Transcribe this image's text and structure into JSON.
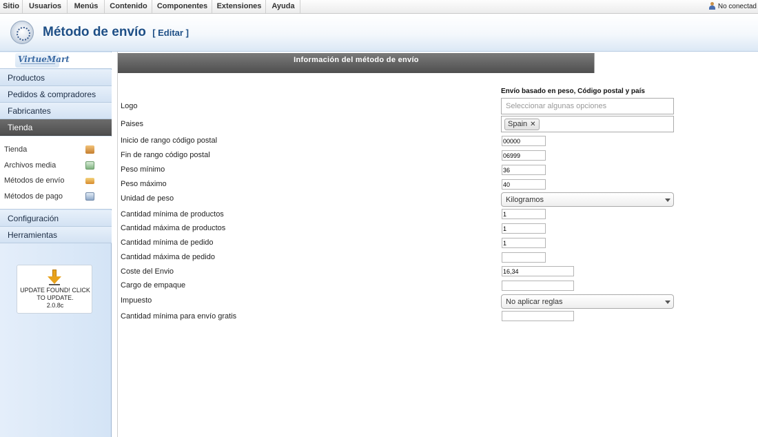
{
  "topmenu": {
    "items": [
      "Sitio",
      "Usuarios",
      "Menús",
      "Contenido",
      "Componentes",
      "Extensiones",
      "Ayuda"
    ],
    "status": "No conectad"
  },
  "header": {
    "title": "Método de envío",
    "edit_label": "[ Editar ]"
  },
  "sidebar": {
    "logo_text": "VirtueMart",
    "sections": [
      "Productos",
      "Pedidos & compradores",
      "Fabricantes",
      "Tienda"
    ],
    "active_section": "Tienda",
    "subitems": [
      "Tienda",
      "Archivos media",
      "Métodos de envío",
      "Métodos de pago"
    ],
    "bottom_sections": [
      "Configuración",
      "Herramientas"
    ],
    "update_notice": "UPDATE FOUND! CLICK TO UPDATE.",
    "version": "2.0.8c"
  },
  "main": {
    "tab_label": "Información del método de envío",
    "section_title": "Envío basado en peso, Código postal y país",
    "fields": {
      "logo": {
        "label": "Logo",
        "placeholder": "Seleccionar algunas opciones"
      },
      "paises": {
        "label": "Paises",
        "chips": [
          "Spain"
        ],
        "remove_symbol": "✕"
      },
      "zip_start": {
        "label": "Inicio de rango código postal",
        "value": "00000"
      },
      "zip_stop": {
        "label": "Fin de rango código postal",
        "value": "06999"
      },
      "weight_min": {
        "label": "Peso mínimo",
        "value": "36"
      },
      "weight_max": {
        "label": "Peso máximo",
        "value": "40"
      },
      "weight_unit": {
        "label": "Unidad de peso",
        "value": "Kilogramos"
      },
      "qty_min_products": {
        "label": "Cantidad mínima de productos",
        "value": "1"
      },
      "qty_max_products": {
        "label": "Cantidad máxima de productos",
        "value": "1"
      },
      "qty_min_order": {
        "label": "Cantidad mínima de pedido",
        "value": "1"
      },
      "qty_max_order": {
        "label": "Cantidad máxima de pedido",
        "value": ""
      },
      "shipping_cost": {
        "label": "Coste del Envio",
        "value": "16,34"
      },
      "package_fee": {
        "label": "Cargo de empaque",
        "value": ""
      },
      "tax": {
        "label": "Impuesto",
        "value": "No aplicar reglas"
      },
      "free_shipping": {
        "label": "Cantidad mínima para envío gratis",
        "value": ""
      }
    }
  }
}
